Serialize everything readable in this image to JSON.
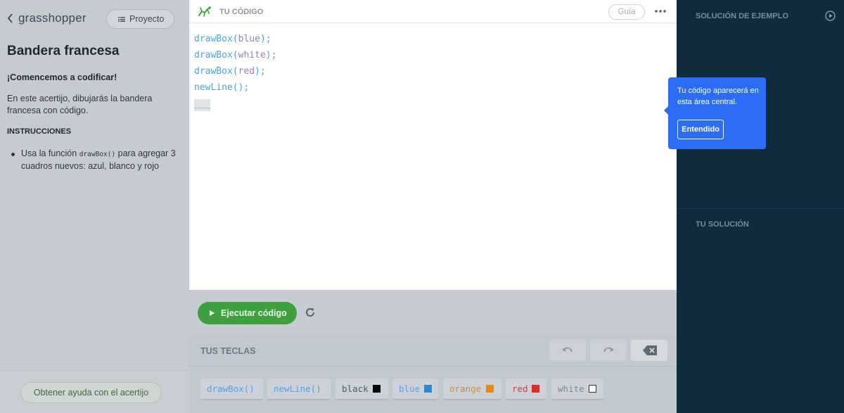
{
  "brand": {
    "logo_text": "grasshopper"
  },
  "left_panel": {
    "project_button": "Proyecto",
    "puzzle_title": "Bandera francesa",
    "intro_heading": "¡Comencemos a codificar!",
    "intro_text": "En este acertijo, dibujarás la bandera francesa con código.",
    "instructions_heading": "INSTRUCCIONES",
    "instruction_prefix": "Usa la función ",
    "instruction_code": "drawBox()",
    "instruction_suffix": " para agregar 3 cuadros nuevos: azul, blanco y rojo",
    "help_button": "Obtener ayuda con el acertijo"
  },
  "editor": {
    "title": "TU CÓDIGO",
    "guide_button": "Guía",
    "lines": [
      {
        "fn": "drawBox",
        "arg": "blue"
      },
      {
        "fn": "drawBox",
        "arg": "white"
      },
      {
        "fn": "drawBox",
        "arg": "red"
      },
      {
        "fn": "newLine",
        "arg": ""
      }
    ],
    "cursor_placeholder": "___"
  },
  "run": {
    "button": "Ejecutar código"
  },
  "keys": {
    "title": "TUS TECLAS",
    "items": [
      {
        "label": "drawBox()",
        "type": "fn"
      },
      {
        "label": "newLine()",
        "type": "fn"
      },
      {
        "label": "black",
        "type": "color",
        "color": "#000000"
      },
      {
        "label": "blue",
        "type": "color",
        "color": "#2b86d9"
      },
      {
        "label": "orange",
        "type": "color",
        "color": "#e88b14"
      },
      {
        "label": "red",
        "type": "color",
        "color": "#d7302b"
      },
      {
        "label": "white",
        "type": "color",
        "color": "#ffffff"
      }
    ]
  },
  "right_panel": {
    "example_heading": "SOLUCIÓN DE EJEMPLO",
    "solution_heading": "TU SOLUCIÓN"
  },
  "tooltip": {
    "text": "Tu código aparecerá en esta área central.",
    "button": "Entendido"
  },
  "colors": {
    "accent_green": "#3ea13e",
    "tooltip_blue": "#2d6df6",
    "right_bg": "#0f2b3c",
    "code_fn": "#4da3dd",
    "code_arg": "#9880b8"
  }
}
